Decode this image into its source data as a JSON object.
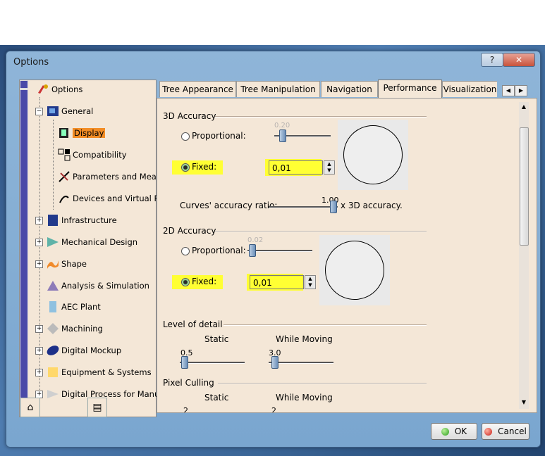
{
  "window": {
    "title": "Options",
    "help_label": "?",
    "close_label": "✕"
  },
  "tree": {
    "items": [
      {
        "label": "Options",
        "icon": "options-icon"
      },
      {
        "label": "General",
        "icon": "general-icon"
      },
      {
        "label": "Display",
        "icon": "display-icon",
        "selected": true
      },
      {
        "label": "Compatibility",
        "icon": "compatibility-icon"
      },
      {
        "label": "Parameters and Measur",
        "icon": "parameters-icon"
      },
      {
        "label": "Devices and Virtual Rea",
        "icon": "devices-icon"
      },
      {
        "label": "Infrastructure",
        "icon": "infrastructure-icon"
      },
      {
        "label": "Mechanical Design",
        "icon": "mechanical-design-icon"
      },
      {
        "label": "Shape",
        "icon": "shape-icon"
      },
      {
        "label": "Analysis & Simulation",
        "icon": "analysis-icon"
      },
      {
        "label": "AEC Plant",
        "icon": "aec-plant-icon"
      },
      {
        "label": "Machining",
        "icon": "machining-icon"
      },
      {
        "label": "Digital Mockup",
        "icon": "digital-mockup-icon"
      },
      {
        "label": "Equipment & Systems",
        "icon": "equipment-icon"
      },
      {
        "label": "Digital Process for Manufa",
        "icon": "digital-process-icon"
      }
    ]
  },
  "tabs": [
    "Tree Appearance",
    "Tree Manipulation",
    "Navigation",
    "Performance",
    "Visualization"
  ],
  "active_tab": "Performance",
  "accuracy3d": {
    "title": "3D Accuracy",
    "proportional_label": "Proportional:",
    "proportional_value": "0.20",
    "fixed_label": "Fixed:",
    "fixed_value": "0,01",
    "curves_label": "Curves' accuracy ratio:",
    "curves_value": "1.00",
    "curves_suffix": "x 3D accuracy."
  },
  "accuracy2d": {
    "title": "2D Accuracy",
    "proportional_label": "Proportional:",
    "proportional_value": "0.02",
    "fixed_label": "Fixed:",
    "fixed_value": "0,01"
  },
  "level_of_detail": {
    "title": "Level of detail",
    "static_label": "Static",
    "moving_label": "While Moving",
    "static_value": "0.5",
    "moving_value": "3.0"
  },
  "pixel_culling": {
    "title": "Pixel Culling",
    "static_label": "Static",
    "moving_label": "While Moving",
    "static_value": "2",
    "moving_value": "2"
  },
  "buttons": {
    "ok": "OK",
    "cancel": "Cancel"
  },
  "colors": {
    "highlight": "#ffff33",
    "selected": "#f28c24",
    "panel": "#f4e7d7"
  }
}
